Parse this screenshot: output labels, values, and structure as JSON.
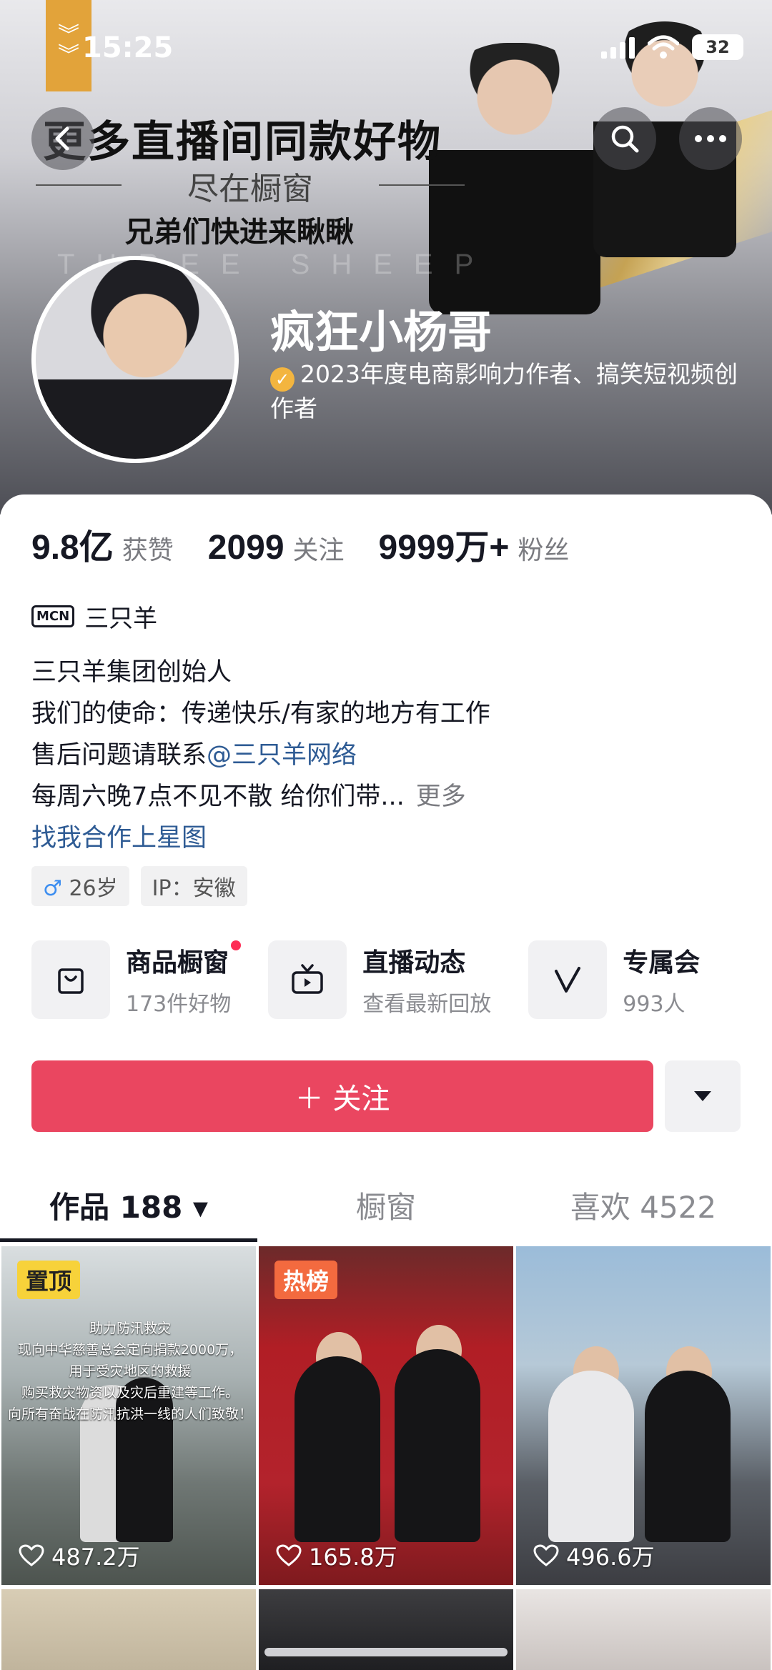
{
  "status_bar": {
    "time": "15:25",
    "battery": "32"
  },
  "banner": {
    "headline": "更多直播间同款好物",
    "subline": "尽在橱窗",
    "subline2": "兄弟们快进来瞅瞅",
    "watermark": "THREE SHEEP"
  },
  "profile": {
    "name": "疯狂小杨哥",
    "verification": "2023年度电商影响力作者、搞笑短视频创作者"
  },
  "stats": [
    {
      "value": "9.8亿",
      "label": "获赞"
    },
    {
      "value": "2099",
      "label": "关注"
    },
    {
      "value": "9999万+",
      "label": "粉丝"
    }
  ],
  "mcn": {
    "icon_text": "MCN",
    "name": "三只羊"
  },
  "bio": {
    "line1": "三只羊集团创始人",
    "line2": "我们的使命：传递快乐/有家的地方有工作",
    "line3_prefix": "售后问题请联系",
    "line3_mention": "@三只羊网络",
    "line4": "每周六晚7点不见不散  给你们带...",
    "more": "更多",
    "starmap_link": "找我合作上星图"
  },
  "tags": {
    "gender_symbol": "♂",
    "age": "26岁",
    "ip": "IP：安徽"
  },
  "shortcuts": [
    {
      "title": "商品橱窗",
      "sub": "173件好物",
      "icon": "shopping-bag-icon"
    },
    {
      "title": "直播动态",
      "sub": "查看最新回放",
      "icon": "tv-icon"
    },
    {
      "title": "专属会",
      "sub": "993人",
      "icon": "v-icon"
    }
  ],
  "follow_button": "＋ 关注",
  "tabs": [
    {
      "label": "作品 188 ▾"
    },
    {
      "label": "橱窗"
    },
    {
      "label": "喜欢 4522"
    }
  ],
  "videos": [
    {
      "badge": "置顶",
      "likes": "487.2万",
      "caption": [
        "助力防汛救灾",
        "现向中华慈善总会定向捐款2000万，",
        "用于受灾地区的救援",
        "购买救灾物资以及灾后重建等工作。",
        "向所有奋战在防汛抗洪一线的人们致敬！"
      ]
    },
    {
      "badge": "热榜",
      "likes": "165.8万"
    },
    {
      "badge": "",
      "likes": "496.6万"
    }
  ]
}
